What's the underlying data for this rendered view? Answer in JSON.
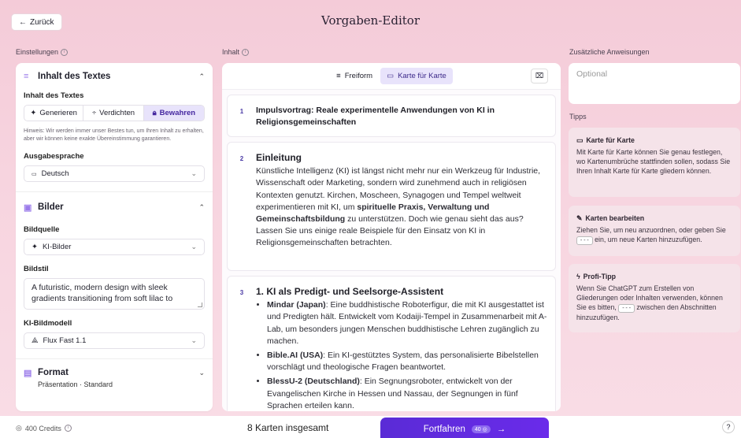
{
  "header": {
    "back_label": "Zurück",
    "title": "Vorgaben-Editor"
  },
  "labels": {
    "settings": "Einstellungen",
    "content": "Inhalt",
    "extra": "Zusätzliche Anweisungen",
    "tips": "Tipps"
  },
  "text_section": {
    "title": "Inhalt des Textes",
    "field_label": "Inhalt des Textes",
    "options": [
      "Generieren",
      "Verdichten",
      "Bewahren"
    ],
    "selected": "Bewahren",
    "hint": "Hinweis: Wir werden immer unser Bestes tun, um Ihren Inhalt zu erhalten, aber wir können keine exakte Übereinstimmung garantieren.",
    "language_label": "Ausgabesprache",
    "language_value": "Deutsch"
  },
  "image_section": {
    "title": "Bilder",
    "source_label": "Bildquelle",
    "source_value": "KI-Bilder",
    "style_label": "Bildstil",
    "style_value": "A futuristic, modern design with sleek gradients transitioning from soft lilac to",
    "model_label": "KI-Bildmodell",
    "model_value": "Flux Fast 1.1"
  },
  "format_section": {
    "title": "Format",
    "subtitle": "Präsentation · Standard"
  },
  "editor": {
    "mode_freeform": "Freiform",
    "mode_cards": "Karte für Karte",
    "cards": [
      {
        "num": "1",
        "title": "Impulsvortrag: Reale experimentelle Anwendungen von KI in Religionsgemeinschaften"
      },
      {
        "num": "2",
        "heading": "Einleitung",
        "text_a": "Künstliche Intelligenz (KI) ist längst nicht mehr nur ein Werkzeug für Industrie, Wissenschaft oder Marketing, sondern wird zunehmend auch in religiösen Kontexten genutzt. Kirchen, Moscheen, Synagogen und Tempel weltweit experimentieren mit KI, um ",
        "text_bold": "spirituelle Praxis, Verwaltung und Gemeinschaftsbildung",
        "text_b": " zu unterstützen. Doch wie genau sieht das aus? Lassen Sie uns einige reale Beispiele für den Einsatz von KI in Religionsgemeinschaften betrachten."
      },
      {
        "num": "3",
        "heading": "1. KI als Predigt- und Seelsorge-Assistent",
        "items": [
          {
            "bold": "Mindar (Japan)",
            "text": ": Eine buddhistische Roboterfigur, die mit KI ausgestattet ist und Predigten hält. Entwickelt vom Kodaiji-Tempel in Zusammenarbeit mit A-Lab, um besonders jungen Menschen buddhistische Lehren zugänglich zu machen."
          },
          {
            "bold": "Bible.AI (USA)",
            "text": ": Ein KI-gestütztes System, das personalisierte Bibelstellen vorschlägt und theologische Fragen beantwortet."
          },
          {
            "bold": "BlessU-2 (Deutschland)",
            "text": ": Ein Segnungsroboter, entwickelt von der Evangelischen Kirche in Hessen und Nassau, der Segnungen in fünf Sprachen erteilen kann."
          }
        ]
      }
    ]
  },
  "right": {
    "placeholder": "Optional",
    "tip1": {
      "title": "Karte für Karte",
      "text": "Mit Karte für Karte können Sie genau festlegen, wo Kartenumbrüche stattfinden sollen, sodass Sie Ihren Inhalt Karte für Karte gliedern können."
    },
    "tip2": {
      "title": "Karten bearbeiten",
      "text_a": "Ziehen Sie, um neu anzuordnen, oder geben Sie ",
      "code": "---",
      "text_b": " ein, um neue Karten hinzuzufügen."
    },
    "tip3": {
      "title": "Profi-Tipp",
      "text_a": "Wenn Sie ChatGPT zum Erstellen von Gliederungen oder Inhalten verwenden, können Sie es bitten, ",
      "code": "---",
      "text_b": " zwischen den Abschnitten hinzuzufügen."
    }
  },
  "footer": {
    "credits": "400 Credits",
    "total": "8 Karten insgesamt",
    "continue": "Fortfahren",
    "cost": "40"
  }
}
